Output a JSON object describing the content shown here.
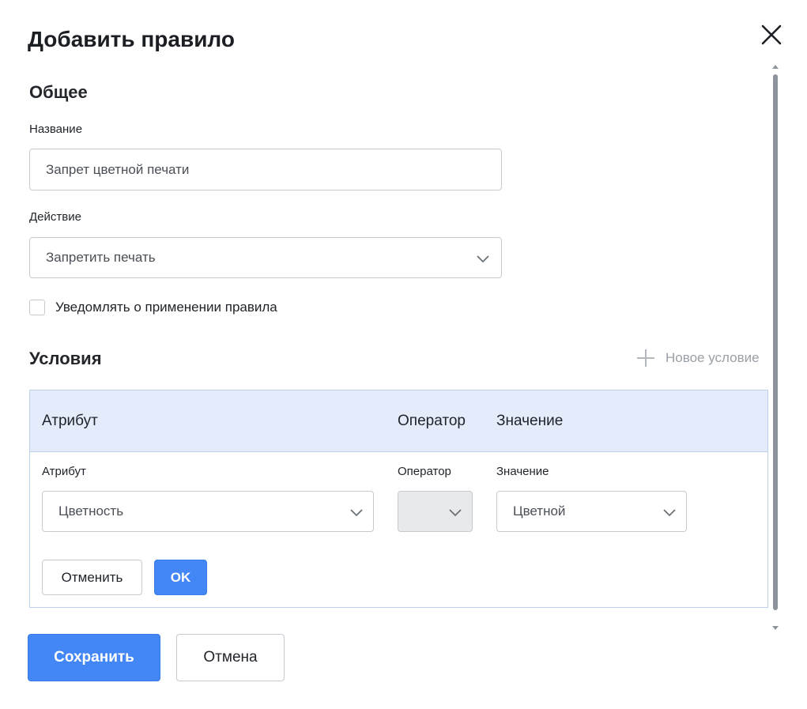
{
  "dialog": {
    "title": "Добавить правило"
  },
  "general": {
    "section_title": "Общее",
    "name_label": "Название",
    "name_value": "Запрет цветной печати",
    "action_label": "Действие",
    "action_value": "Запретить печать",
    "notify_label": "Уведомлять о применении правила",
    "notify_checked": false
  },
  "conditions": {
    "section_title": "Условия",
    "new_condition_label": "Новое условие",
    "columns": [
      "Атрибут",
      "Оператор",
      "Значение"
    ],
    "editor": {
      "attribute_label": "Атрибут",
      "attribute_value": "Цветность",
      "operator_label": "Оператор",
      "operator_value": "",
      "value_label": "Значение",
      "value_value": "Цветной",
      "cancel_label": "Отменить",
      "ok_label": "OK"
    }
  },
  "footer": {
    "save_label": "Сохранить",
    "cancel_label": "Отмена"
  },
  "colors": {
    "primary": "#4386f5",
    "table_header_bg": "#e4ecfb",
    "table_border": "#bcd0ea",
    "muted_text": "#9aa0a7"
  },
  "icons": {
    "close": "close-icon",
    "chevron": "chevron-down-icon",
    "add": "plus-icon"
  }
}
